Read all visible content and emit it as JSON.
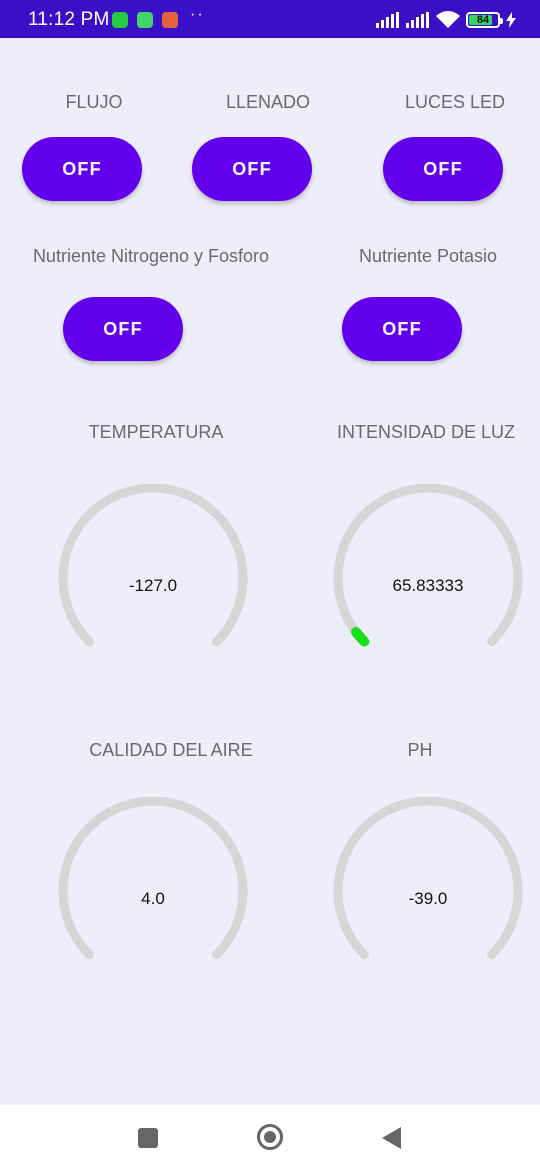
{
  "status_bar": {
    "time": "11:12 PM",
    "dots": "··",
    "battery": "84",
    "colors": {
      "background": "#3a10c6"
    }
  },
  "controls": {
    "flujo": {
      "label": "FLUJO",
      "state": "OFF"
    },
    "llenado": {
      "label": "LLENADO",
      "state": "OFF"
    },
    "luces_led": {
      "label": "LUCES LED",
      "state": "OFF"
    },
    "nutriente_nf": {
      "label": "Nutriente Nitrogeno y Fosforo",
      "state": "OFF"
    },
    "nutriente_k": {
      "label": "Nutriente Potasio",
      "state": "OFF"
    }
  },
  "gauges": {
    "temperatura": {
      "label": "TEMPERATURA",
      "value": "-127.0",
      "fill": 0
    },
    "intensidad_luz": {
      "label": "INTENSIDAD DE LUZ",
      "value": "65.83333",
      "fill": 0.03
    },
    "calidad_aire": {
      "label": "CALIDAD DEL AIRE",
      "value": "4.0",
      "fill": 0
    },
    "ph": {
      "label": "PH",
      "value": "-39.0",
      "fill": 0
    }
  },
  "colors": {
    "accent": "#6200ee",
    "gauge_track": "#d6d6d6",
    "gauge_progress": "#16e016",
    "background": "#eeeefa"
  },
  "nav": {
    "recents_icon": "square-icon",
    "home_icon": "circle-home-icon",
    "back_icon": "triangle-back-icon"
  }
}
